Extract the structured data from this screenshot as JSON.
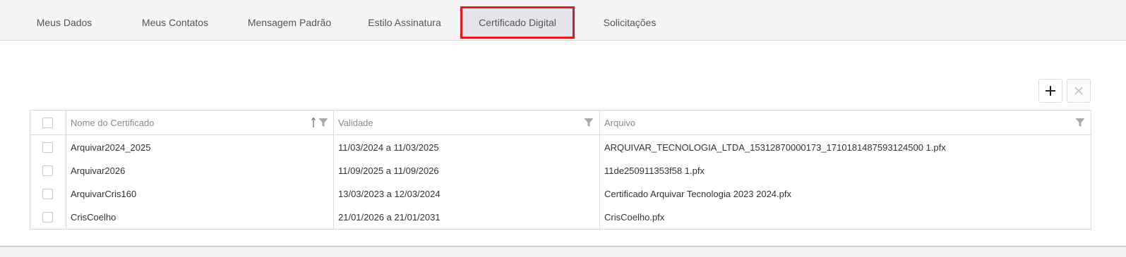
{
  "tabs": [
    {
      "label": "Meus Dados",
      "active": false
    },
    {
      "label": "Meus Contatos",
      "active": false
    },
    {
      "label": "Mensagem Padrão",
      "active": false
    },
    {
      "label": "Estilo Assinatura",
      "active": false
    },
    {
      "label": "Certificado Digital",
      "active": true
    },
    {
      "label": "Solicitações",
      "active": false
    }
  ],
  "toolbar": {
    "add_icon": "plus-icon",
    "remove_icon": "close-icon"
  },
  "grid": {
    "columns": [
      {
        "label": "Nome do Certificado",
        "sorted": "ascending",
        "filter": true
      },
      {
        "label": "Validade",
        "filter": true
      },
      {
        "label": "Arquivo",
        "filter": true
      }
    ],
    "rows": [
      {
        "name": "Arquivar2024_2025",
        "validity": "11/03/2024 a 11/03/2025",
        "file": "ARQUIVAR_TECNOLOGIA_LTDA_15312870000173_1710181487593124500 1.pfx"
      },
      {
        "name": "Arquivar2026",
        "validity": "11/09/2025 a 11/09/2026",
        "file": "11de250911353f58 1.pfx"
      },
      {
        "name": "ArquivarCris160",
        "validity": "13/03/2023 a 12/03/2024",
        "file": "Certificado Arquivar Tecnologia 2023 2024.pfx"
      },
      {
        "name": "CrisCoelho",
        "validity": "21/01/2026 a 21/01/2031",
        "file": "CrisCoelho.pfx"
      }
    ]
  },
  "colors": {
    "active_tab_border": "#e01b1b",
    "active_tab_bg": "#e6e3ec",
    "tabbar_bg": "#f4f4f4",
    "grid_border": "#d9d9d9"
  }
}
